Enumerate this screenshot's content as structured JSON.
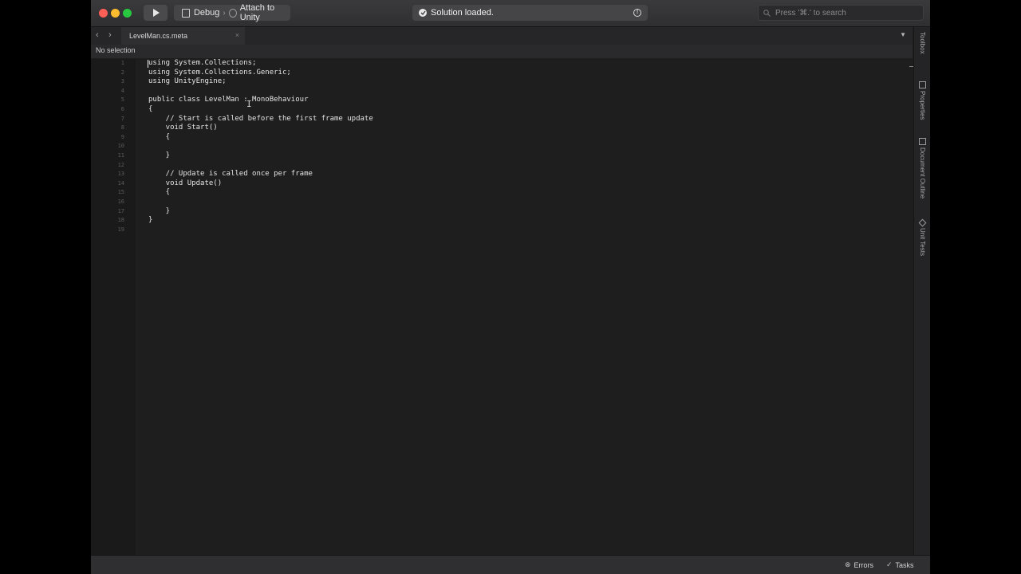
{
  "toolbar": {
    "configuration": "Debug",
    "target": "Attach to Unity",
    "status": "Solution loaded.",
    "search_placeholder": "Press '⌘.' to search"
  },
  "tabs": {
    "back": "‹",
    "forward": "›",
    "active_tab": "LevelMan.cs.meta",
    "close": "×",
    "dropdown": "▼"
  },
  "breadcrumb": "No selection",
  "editor": {
    "line_numbers": [
      "1",
      "2",
      "3",
      "4",
      "5",
      "6",
      "7",
      "8",
      "9",
      "10",
      "11",
      "12",
      "13",
      "14",
      "15",
      "16",
      "17",
      "18",
      "19"
    ],
    "lines": [
      "using System.Collections;",
      "using System.Collections.Generic;",
      "using UnityEngine;",
      "",
      "public class LevelMan : MonoBehaviour",
      "{",
      "    // Start is called before the first frame update",
      "    void Start()",
      "    {",
      "",
      "    }",
      "",
      "    // Update is called once per frame",
      "    void Update()",
      "    {",
      "",
      "    }",
      "}",
      ""
    ]
  },
  "sidepanel": [
    "Toolbox",
    "Properties",
    "Document Outline",
    "Unit Tests"
  ],
  "bottombar": {
    "errors": "Errors",
    "tasks": "Tasks"
  },
  "colors": {
    "close": "#fe5f57",
    "minimize": "#febc2e",
    "zoom": "#28c840",
    "editor_bg": "#1e1e1f"
  }
}
